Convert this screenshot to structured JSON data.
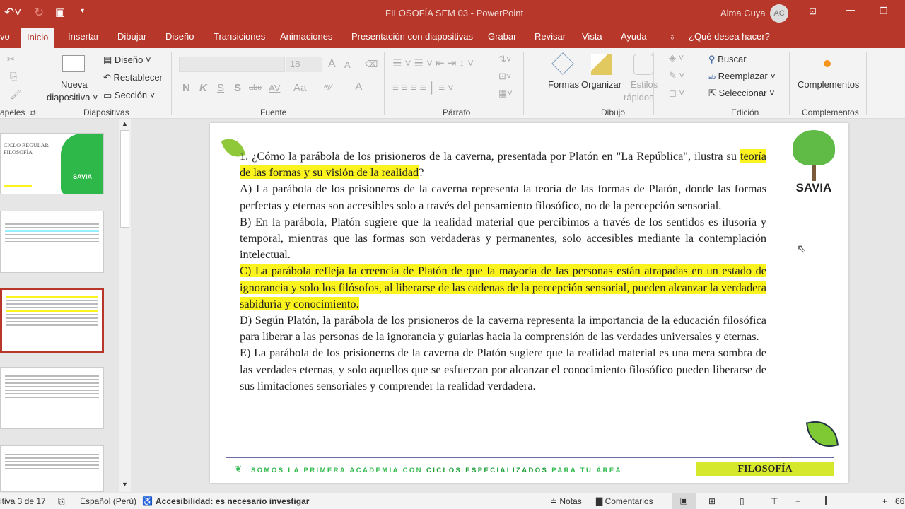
{
  "titlebar": {
    "title": "FILOSOFÍA SEM 03  -  PowerPoint",
    "user": "Alma Cuya",
    "avatar": "AC"
  },
  "tabs": [
    "vo",
    "Inicio",
    "Insertar",
    "Dibujar",
    "Diseño",
    "Transiciones",
    "Animaciones",
    "Presentación con diapositivas",
    "Grabar",
    "Revisar",
    "Vista",
    "Ayuda"
  ],
  "tell_me": "¿Qué desea hacer?",
  "ribbon": {
    "new_slide": "Nueva",
    "new_slide2": "diapositiva ˅",
    "layout": "Diseño ˅",
    "reset": "Restablecer",
    "section": "Sección ˅",
    "font_size": "18",
    "bold": "N",
    "italic": "K",
    "underline": "S",
    "shadow": "S",
    "strike": "abc",
    "spacing": "AV",
    "case": "Aa",
    "shapes": "Formas",
    "arrange": "Organizar",
    "styles": "Estilos",
    "styles2": "rápidos",
    "find": "Buscar",
    "replace": "Reemplazar",
    "select": "Seleccionar",
    "addins": "Complementos",
    "groups": {
      "clipboard": "apeles",
      "slides": "Diapositivas",
      "font": "Fuente",
      "paragraph": "Párrafo",
      "drawing": "Dibujo",
      "editing": "Edición",
      "addins": "Complementos"
    }
  },
  "thumbs": {
    "t1_title": "CICLO REGULAR",
    "t1_sub": "FILOSOFÍA",
    "t1_logo": "SAVIA"
  },
  "slide": {
    "q_a": "1. ¿Cómo la parábola de los prisioneros de la caverna, presentada por Platón en \"La República\", ilustra su ",
    "q_b": "teoría de las formas y su visión de la realidad",
    "q_c": "?",
    "a": "A) La parábola de los prisioneros de la caverna representa la teoría de las formas de Platón, donde las formas perfectas y eternas son accesibles solo a través del pensamiento filosófico, no de la percepción sensorial.",
    "b": "B) En la parábola, Platón sugiere que la realidad material que percibimos a través de los sentidos es ilusoria y temporal, mientras que las formas son verdaderas y permanentes, solo accesibles mediante la contemplación intelectual.",
    "c": "C) La parábola refleja la creencia de Platón de que la mayoría de las personas están atrapadas en un estado de ignorancia y solo los filósofos, al liberarse de las cadenas de la percepción sensorial, pueden alcanzar la verdadera sabiduría y conocimiento.",
    "d": "D) Según Platón, la parábola de los prisioneros de la caverna representa la importancia de la educación filosófica para liberar a las personas de la ignorancia y guiarlas hacia la comprensión de las verdades universales y eternas.",
    "e": "E) La parábola de los prisioneros de la caverna de Platón sugiere que la realidad material es una mera sombra de las verdades eternas, y solo aquellos que se esfuerzan por alcanzar el conocimiento filosófico pueden liberarse de sus limitaciones sensoriales y comprender la realidad verdadera.",
    "logo": "SAVIA",
    "footer_a": "SOMOS LA PRIMERA ACADEMIA CON ",
    "footer_b": "CICLOS ESPECIALIZADOS",
    "footer_c": " PARA TU ÁREA",
    "badge": "FILOSOFÍA"
  },
  "status": {
    "slide": "itiva 3 de 17",
    "lang": "Español (Perú)",
    "access": "Accesibilidad: es necesario investigar",
    "notes": "Notas",
    "comments": "Comentarios",
    "zoom": "66"
  },
  "colors": {
    "accent": "#b7382b",
    "highlight": "#fbf31d",
    "green": "#2fb84a"
  }
}
